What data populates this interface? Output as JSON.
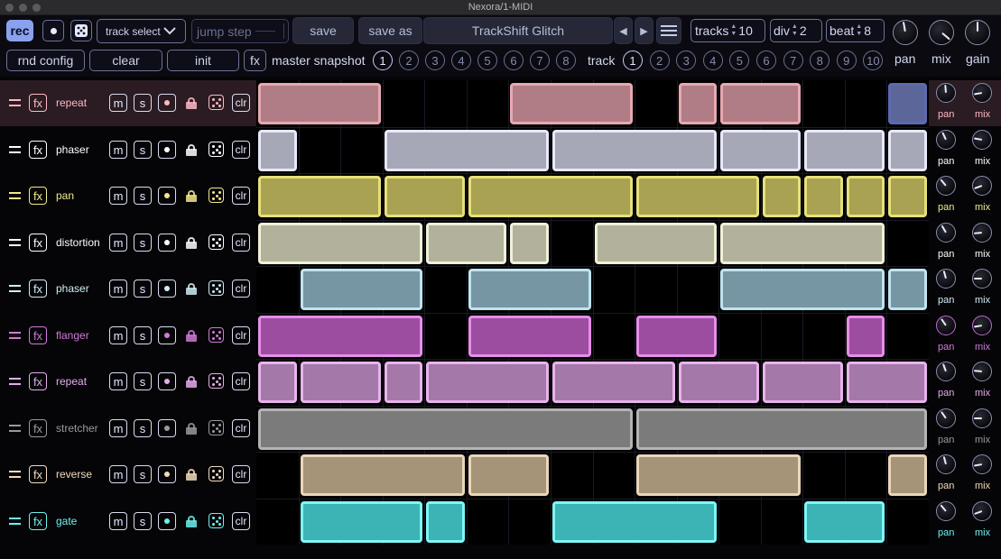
{
  "window": {
    "title": "Nexora/1-MIDI"
  },
  "toolbar": {
    "rec": "rec",
    "track_select": "track select",
    "jump_step": "jump step",
    "save": "save",
    "save_as": "save as",
    "preset_name": "TrackShift Glitch",
    "tracks_label": "tracks",
    "tracks_value": "10",
    "div_label": "div",
    "div_value": "2",
    "beat_label": "beat",
    "beat_value": "8",
    "rnd_config": "rnd config",
    "clear": "clear",
    "init": "init",
    "fx": "fx",
    "master_snapshot_label": "master snapshot",
    "master_snapshots": [
      "1",
      "2",
      "3",
      "4",
      "5",
      "6",
      "7",
      "8"
    ],
    "master_selected": 0,
    "track_label": "track",
    "track_numbers": [
      "1",
      "2",
      "3",
      "4",
      "5",
      "6",
      "7",
      "8",
      "9",
      "10"
    ],
    "track_selected": 0,
    "pan_label": "pan",
    "mix_label": "mix",
    "gain_label": "gain"
  },
  "track_buttons": {
    "fx": "fx",
    "mute": "m",
    "solo": "s",
    "clear": "clr"
  },
  "knob_labels": {
    "pan": "pan",
    "mix": "mix"
  },
  "tracks": [
    {
      "name": "repeat",
      "color": "#e8a8b0",
      "fill": "#b07c86",
      "ui": "#ffb8c4",
      "segments": [
        [
          0,
          3
        ],
        [
          6,
          9
        ],
        [
          10,
          11
        ],
        [
          11,
          13
        ],
        [
          15,
          16,
          "#5c6699"
        ]
      ]
    },
    {
      "name": "phaser",
      "color": "#e7e8f8",
      "fill": "#a6a8b8",
      "ui": "#ffffff",
      "segments": [
        [
          0,
          1
        ],
        [
          3,
          7
        ],
        [
          7,
          11
        ],
        [
          11,
          13
        ],
        [
          13,
          15
        ],
        [
          15,
          16
        ]
      ]
    },
    {
      "name": "pan",
      "color": "#e7e07a",
      "fill": "#a8a252",
      "ui": "#f1ea8c",
      "segments": [
        [
          0,
          3
        ],
        [
          3,
          5
        ],
        [
          5,
          9
        ],
        [
          9,
          12
        ],
        [
          12,
          13
        ],
        [
          13,
          14
        ],
        [
          14,
          15
        ],
        [
          15,
          16
        ]
      ]
    },
    {
      "name": "distortion",
      "color": "#f0f0d8",
      "fill": "#b2b29c",
      "ui": "#ffffff",
      "segments": [
        [
          0,
          4
        ],
        [
          4,
          6
        ],
        [
          6,
          7
        ],
        [
          8,
          11
        ],
        [
          11,
          15
        ]
      ]
    },
    {
      "name": "phaser",
      "color": "#bfe3ef",
      "fill": "#7796a4",
      "ui": "#d2ecf4",
      "segments": [
        [
          1,
          4
        ],
        [
          5,
          8
        ],
        [
          11,
          15
        ],
        [
          15,
          16
        ]
      ]
    },
    {
      "name": "flanger",
      "color": "#e58ee9",
      "fill": "#9d4da0",
      "ui": "#d07ad6",
      "segments": [
        [
          0,
          4
        ],
        [
          5,
          8
        ],
        [
          9,
          11
        ],
        [
          14,
          15
        ]
      ]
    },
    {
      "name": "repeat",
      "color": "#e8b3ec",
      "fill": "#a478a8",
      "ui": "#e2aee8",
      "segments": [
        [
          0,
          1
        ],
        [
          1,
          3
        ],
        [
          3,
          4
        ],
        [
          4,
          7
        ],
        [
          7,
          10
        ],
        [
          10,
          12
        ],
        [
          12,
          14
        ],
        [
          14,
          16
        ]
      ]
    },
    {
      "name": "stretcher",
      "color": "#b4b4b4",
      "fill": "#7b7b7b",
      "ui": "#9a9a9a",
      "segments": [
        [
          0,
          9
        ],
        [
          9,
          16
        ]
      ]
    },
    {
      "name": "reverse",
      "color": "#ead6b8",
      "fill": "#a69478",
      "ui": "#f1dcba",
      "segments": [
        [
          1,
          5
        ],
        [
          5,
          7
        ],
        [
          9,
          13
        ],
        [
          15,
          16
        ]
      ]
    },
    {
      "name": "gate",
      "color": "#7ff6f6",
      "fill": "#3cb3b4",
      "ui": "#6ff0ee",
      "segments": [
        [
          1,
          4
        ],
        [
          4,
          5
        ],
        [
          7,
          11
        ],
        [
          13,
          15
        ]
      ]
    }
  ]
}
